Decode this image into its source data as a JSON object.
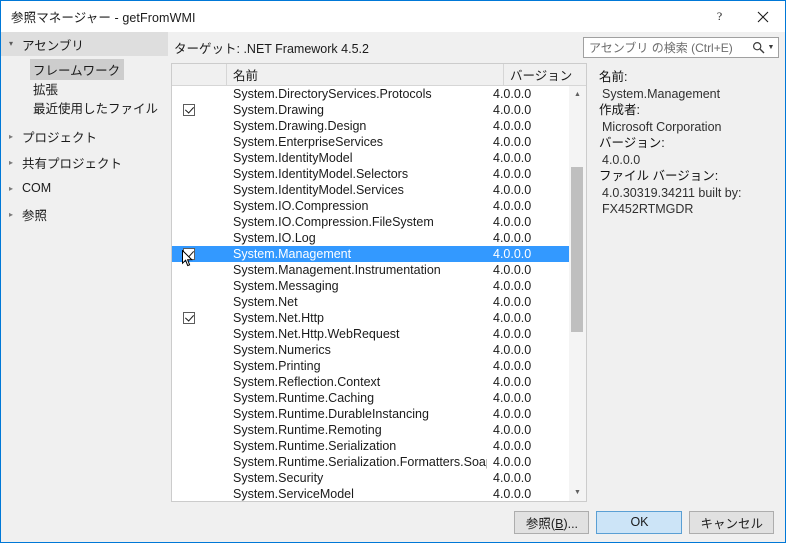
{
  "window": {
    "title": "参照マネージャー - getFromWMI",
    "help_icon": "help-question-icon",
    "close_icon": "close-icon"
  },
  "sidebar": {
    "group": {
      "label": "アセンブリ",
      "expanded_arrow": "▲"
    },
    "children": [
      {
        "label": "フレームワーク",
        "selected": true
      },
      {
        "label": "拡張",
        "selected": false
      },
      {
        "label": "最近使用したファイル",
        "selected": false
      }
    ],
    "nodes": [
      {
        "label": "プロジェクト"
      },
      {
        "label": "共有プロジェクト"
      },
      {
        "label": "COM"
      },
      {
        "label": "参照"
      }
    ]
  },
  "main": {
    "target_label": "ターゲット: .NET Framework 4.5.2",
    "search": {
      "placeholder": "アセンブリ の検索 (Ctrl+E)",
      "value": "",
      "icon": "search-icon",
      "dropdown_icon": "chevron-down-icon"
    }
  },
  "list": {
    "columns": [
      "",
      "名前",
      "バージョン"
    ],
    "rows": [
      {
        "checked": false,
        "name": "System.DirectoryServices.Protocols",
        "version": "4.0.0.0",
        "selected": false
      },
      {
        "checked": true,
        "name": "System.Drawing",
        "version": "4.0.0.0",
        "selected": false
      },
      {
        "checked": false,
        "name": "System.Drawing.Design",
        "version": "4.0.0.0",
        "selected": false
      },
      {
        "checked": false,
        "name": "System.EnterpriseServices",
        "version": "4.0.0.0",
        "selected": false
      },
      {
        "checked": false,
        "name": "System.IdentityModel",
        "version": "4.0.0.0",
        "selected": false
      },
      {
        "checked": false,
        "name": "System.IdentityModel.Selectors",
        "version": "4.0.0.0",
        "selected": false
      },
      {
        "checked": false,
        "name": "System.IdentityModel.Services",
        "version": "4.0.0.0",
        "selected": false
      },
      {
        "checked": false,
        "name": "System.IO.Compression",
        "version": "4.0.0.0",
        "selected": false
      },
      {
        "checked": false,
        "name": "System.IO.Compression.FileSystem",
        "version": "4.0.0.0",
        "selected": false
      },
      {
        "checked": false,
        "name": "System.IO.Log",
        "version": "4.0.0.0",
        "selected": false
      },
      {
        "checked": true,
        "name": "System.Management",
        "version": "4.0.0.0",
        "selected": true
      },
      {
        "checked": false,
        "name": "System.Management.Instrumentation",
        "version": "4.0.0.0",
        "selected": false
      },
      {
        "checked": false,
        "name": "System.Messaging",
        "version": "4.0.0.0",
        "selected": false
      },
      {
        "checked": false,
        "name": "System.Net",
        "version": "4.0.0.0",
        "selected": false
      },
      {
        "checked": true,
        "name": "System.Net.Http",
        "version": "4.0.0.0",
        "selected": false
      },
      {
        "checked": false,
        "name": "System.Net.Http.WebRequest",
        "version": "4.0.0.0",
        "selected": false
      },
      {
        "checked": false,
        "name": "System.Numerics",
        "version": "4.0.0.0",
        "selected": false
      },
      {
        "checked": false,
        "name": "System.Printing",
        "version": "4.0.0.0",
        "selected": false
      },
      {
        "checked": false,
        "name": "System.Reflection.Context",
        "version": "4.0.0.0",
        "selected": false
      },
      {
        "checked": false,
        "name": "System.Runtime.Caching",
        "version": "4.0.0.0",
        "selected": false
      },
      {
        "checked": false,
        "name": "System.Runtime.DurableInstancing",
        "version": "4.0.0.0",
        "selected": false
      },
      {
        "checked": false,
        "name": "System.Runtime.Remoting",
        "version": "4.0.0.0",
        "selected": false
      },
      {
        "checked": false,
        "name": "System.Runtime.Serialization",
        "version": "4.0.0.0",
        "selected": false
      },
      {
        "checked": false,
        "name": "System.Runtime.Serialization.Formatters.Soap",
        "version": "4.0.0.0",
        "selected": false
      },
      {
        "checked": false,
        "name": "System.Security",
        "version": "4.0.0.0",
        "selected": false
      },
      {
        "checked": false,
        "name": "System.ServiceModel",
        "version": "4.0.0.0",
        "selected": false
      }
    ],
    "scrollbar": {
      "up_icon": "scroll-up-icon",
      "down_icon": "scroll-down-icon"
    }
  },
  "details": {
    "name_label": "名前:",
    "name_value": "System.Management",
    "author_label": "作成者:",
    "author_value": "Microsoft Corporation",
    "version_label": "バージョン:",
    "version_value": "4.0.0.0",
    "fileversion_label": "ファイル バージョン:",
    "fileversion_value_1": "4.0.30319.34211 built by:",
    "fileversion_value_2": "FX452RTMGDR"
  },
  "footer": {
    "browse_prefix": "参照(",
    "browse_accel": "B",
    "browse_suffix": ")...",
    "ok_label": "OK",
    "cancel_label": "キャンセル"
  },
  "colors": {
    "accent": "#0078d7",
    "selection": "#3399ff",
    "default_button": "#cce4f7",
    "sidebar_bg": "#f0f0f0"
  }
}
